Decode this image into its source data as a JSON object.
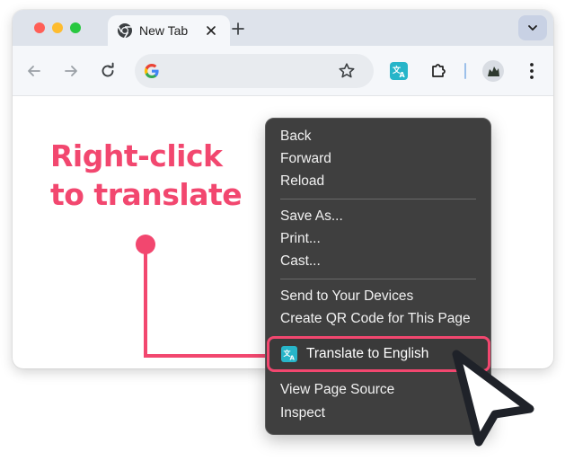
{
  "browser": {
    "tab": {
      "title": "New Tab"
    },
    "omnibox": {
      "value": "",
      "placeholder": ""
    }
  },
  "annotation": {
    "headline": "Right-click to translate"
  },
  "context_menu": {
    "groups": [
      [
        "Back",
        "Forward",
        "Reload"
      ],
      [
        "Save As...",
        "Print...",
        "Cast..."
      ],
      [
        "Send to Your Devices",
        "Create QR Code for This Page"
      ],
      [
        "Translate to English"
      ],
      [
        "View Page Source",
        "Inspect"
      ]
    ],
    "items": {
      "back": "Back",
      "forward": "Forward",
      "reload": "Reload",
      "save_as": "Save As...",
      "print": "Print...",
      "cast": "Cast...",
      "send_to_devices": "Send to Your Devices",
      "create_qr": "Create QR Code for This Page",
      "translate": "Translate to English",
      "view_source": "View Page Source",
      "inspect": "Inspect"
    },
    "highlighted_item": "Translate to English"
  },
  "colors": {
    "accent": "#f2476f",
    "menu_background": "#3f3f3f",
    "translate_icon": "#27b5c9",
    "tab_strip": "#dee3eb",
    "toolbar": "#f5f7fa"
  },
  "icons": [
    "chrome-favicon-icon",
    "close-icon",
    "plus-icon",
    "chevron-down-icon",
    "arrow-left-icon",
    "arrow-right-icon",
    "reload-icon",
    "google-g-icon",
    "star-icon",
    "translate-icon",
    "puzzle-icon",
    "avatar",
    "kebab-menu-icon",
    "mouse-cursor-icon"
  ]
}
